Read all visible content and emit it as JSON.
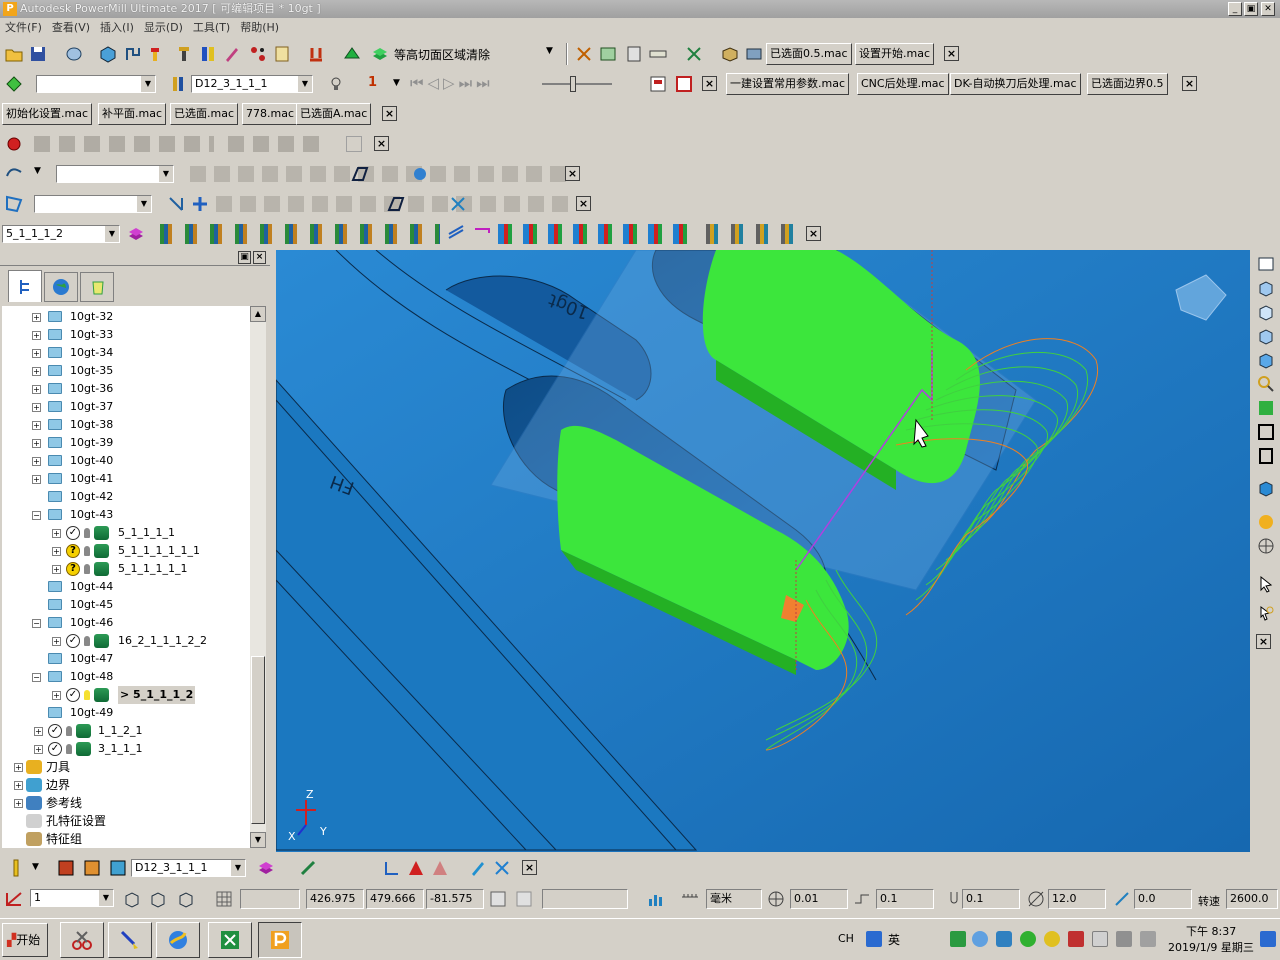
{
  "window": {
    "title": "Autodesk PowerMill Ultimate 2017   [ 可编辑项目 * 10gt ]",
    "min": "_",
    "max": "▣",
    "close": "✕"
  },
  "menu": [
    "文件(F)",
    "查看(V)",
    "插入(I)",
    "显示(D)",
    "工具(T)",
    "帮助(H)"
  ],
  "toolbar1": {
    "strategy_label": "等高切面区域清除",
    "macros": [
      "已选面0.5.mac",
      "设置开始.mac"
    ]
  },
  "toolbar2": {
    "tool_combo": "D12_3_1_1_1",
    "num_label": "1",
    "macros": [
      "一建设置常用参数.mac",
      "CNC后处理.mac",
      "DK-自动换刀后处理.mac",
      "已选面边界0.5"
    ]
  },
  "toolbar3": {
    "macros": [
      "初始化设置.mac",
      "补平面.mac",
      "已选面.mac",
      "778.mac",
      "已选面A.mac"
    ]
  },
  "toolbar7": {
    "toolpath_combo": "5_1_1_1_2"
  },
  "explorer": {
    "rows": [
      {
        "label": "10gt-32",
        "kind": "folder"
      },
      {
        "label": "10gt-33",
        "kind": "folder"
      },
      {
        "label": "10gt-34",
        "kind": "folder"
      },
      {
        "label": "10gt-35",
        "kind": "folder"
      },
      {
        "label": "10gt-36",
        "kind": "folder"
      },
      {
        "label": "10gt-37",
        "kind": "folder"
      },
      {
        "label": "10gt-38",
        "kind": "folder"
      },
      {
        "label": "10gt-39",
        "kind": "folder"
      },
      {
        "label": "10gt-40",
        "kind": "folder"
      },
      {
        "label": "10gt-41",
        "kind": "folder"
      },
      {
        "label": "10gt-42",
        "kind": "folder-noplus"
      },
      {
        "label": "10gt-43",
        "kind": "folder-open"
      },
      {
        "label": "5_1_1_1_1",
        "kind": "path-ok"
      },
      {
        "label": "5_1_1_1_1_1_1",
        "kind": "path-q"
      },
      {
        "label": "5_1_1_1_1_1",
        "kind": "path-q"
      },
      {
        "label": "10gt-44",
        "kind": "folder-noplus"
      },
      {
        "label": "10gt-45",
        "kind": "folder-noplus"
      },
      {
        "label": "10gt-46",
        "kind": "folder-open"
      },
      {
        "label": "16_2_1_1_1_2_2",
        "kind": "path-ok"
      },
      {
        "label": "10gt-47",
        "kind": "folder-noplus"
      },
      {
        "label": "10gt-48",
        "kind": "folder-open"
      },
      {
        "label": "> 5_1_1_1_2",
        "kind": "path-active"
      },
      {
        "label": "10gt-49",
        "kind": "folder-noplus"
      },
      {
        "label": "1_1_2_1",
        "kind": "path-top"
      },
      {
        "label": "3_1_1_1",
        "kind": "path-top"
      },
      {
        "label": "刀具",
        "kind": "root"
      },
      {
        "label": "边界",
        "kind": "root"
      },
      {
        "label": "参考线",
        "kind": "root"
      },
      {
        "label": "孔特征设置",
        "kind": "root-noplus"
      },
      {
        "label": "特征组",
        "kind": "root-noplus"
      }
    ]
  },
  "viewport": {
    "engraving1": "10gt",
    "engraving2": "FH"
  },
  "bottom_toolbar": {
    "tool_combo": "D12_3_1_1_1"
  },
  "statusbar": {
    "workplane": "1",
    "x": "426.975",
    "y": "479.666",
    "z": "-81.575",
    "units": "毫米",
    "tol1": "0.01",
    "tol2": "0.1",
    "tol3": "0.1",
    "diameter": "12.0",
    "feed": "0.0",
    "speed_label": "转速",
    "speed": "2600.0"
  },
  "taskbar": {
    "start": "开始",
    "lang": "CH",
    "ime": "英",
    "time": "下午 8:37",
    "date": "2019/1/9 星期三"
  },
  "colors": {
    "viewport": "#1e7fc5",
    "green_face": "#3ce63c",
    "selection": "#6a4fc8"
  }
}
